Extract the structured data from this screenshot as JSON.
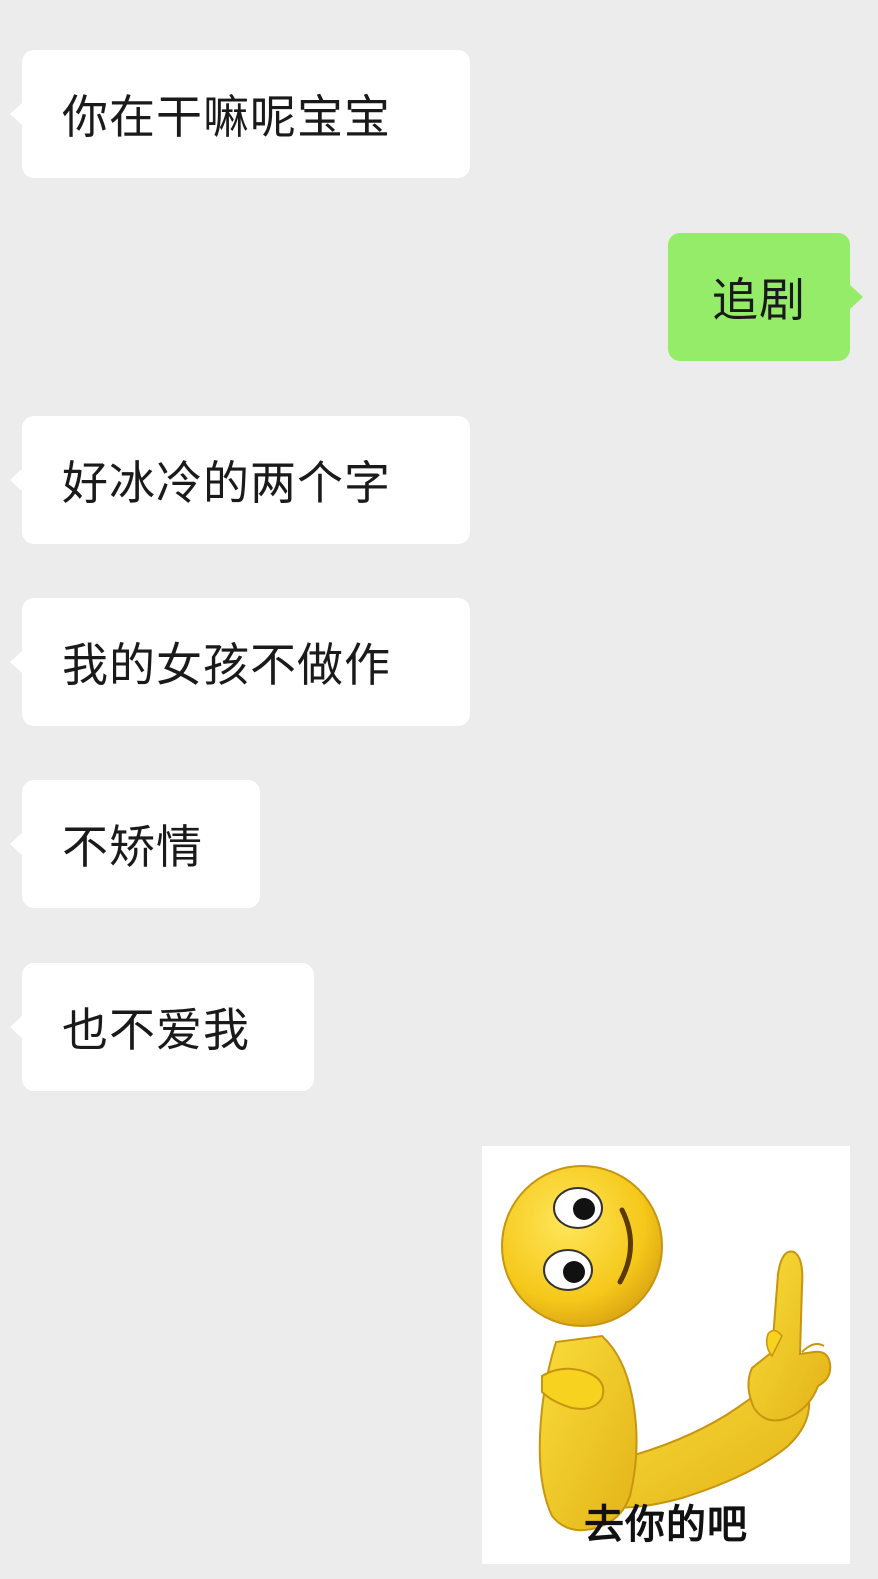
{
  "messages": [
    {
      "side": "left",
      "text": "你在干嘛呢宝宝"
    },
    {
      "side": "right",
      "text": "追剧"
    },
    {
      "side": "left",
      "text": "好冰冷的两个字"
    },
    {
      "side": "left",
      "text": "我的女孩不做作"
    },
    {
      "side": "left",
      "text": "不矫情"
    },
    {
      "side": "left",
      "text": "也不爱我"
    }
  ],
  "sticker": {
    "caption": "去你的吧",
    "icon": "smiley-middle-finger-sticker"
  },
  "colors": {
    "background": "#ececec",
    "incoming_bubble": "#ffffff",
    "outgoing_bubble": "#95ec69",
    "sticker_yellow": "#f7d21e"
  }
}
